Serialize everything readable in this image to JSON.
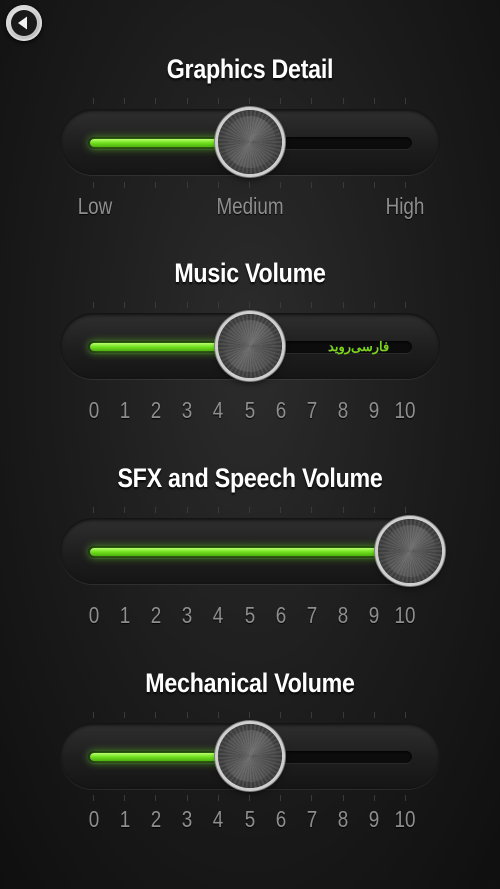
{
  "back": {
    "icon": "back-arrow-icon"
  },
  "sliders": [
    {
      "title": "Graphics Detail",
      "labels": [
        "Low",
        "Medium",
        "High"
      ],
      "fraction": 0.5
    },
    {
      "title": "Music Volume",
      "labels": [
        "0",
        "1",
        "2",
        "3",
        "4",
        "5",
        "6",
        "7",
        "8",
        "9",
        "10"
      ],
      "value": 5,
      "watermark": "فا‌رسی‌روید"
    },
    {
      "title": "SFX and Speech Volume",
      "labels": [
        "0",
        "1",
        "2",
        "3",
        "4",
        "5",
        "6",
        "7",
        "8",
        "9",
        "10"
      ],
      "value": 10
    },
    {
      "title": "Mechanical Volume",
      "labels": [
        "0",
        "1",
        "2",
        "3",
        "4",
        "5",
        "6",
        "7",
        "8",
        "9",
        "10"
      ],
      "value": 5
    }
  ],
  "colors": {
    "accent_green": "#7ee62a",
    "background": "#1b1b1b",
    "label_gray": "#8e8e8e"
  }
}
